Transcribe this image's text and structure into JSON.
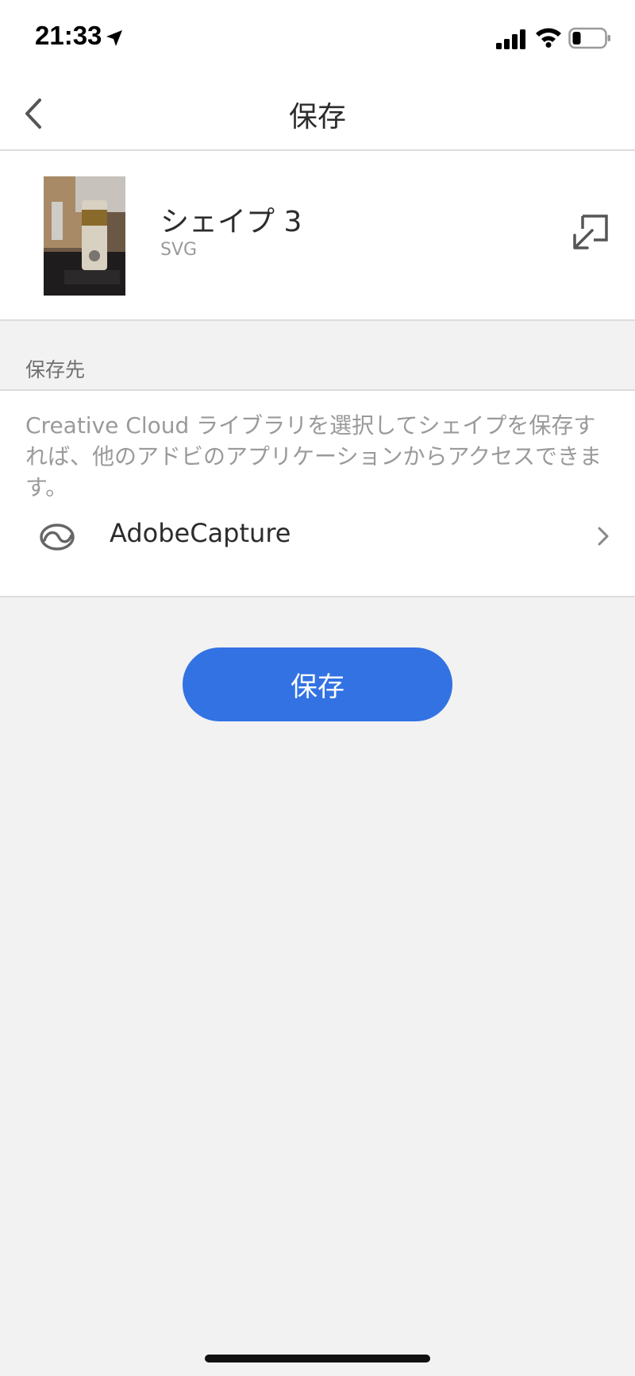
{
  "status_bar": {
    "time": "21:33",
    "icons": [
      "location-arrow-icon",
      "cellular-signal-icon",
      "wifi-icon",
      "battery-icon"
    ]
  },
  "nav": {
    "title": "保存",
    "back_icon": "chevron-left-icon"
  },
  "item": {
    "name": "シェイプ 3",
    "format": "SVG",
    "thumbnail": "photo-thumbnail",
    "export_icon": "export-arrow-icon"
  },
  "destination": {
    "section_label": "保存先",
    "description": "Creative Cloud ライブラリを選択してシェイプを保存すれば、他のアドビのアプリケーションからアクセスできます。",
    "library": {
      "name": "AdobeCapture",
      "icon": "creative-cloud-icon",
      "chevron_icon": "chevron-right-icon"
    }
  },
  "actions": {
    "save_label": "保存"
  },
  "colors": {
    "accent": "#3272e3",
    "background": "#f2f2f3",
    "card": "#ffffff",
    "text_primary": "#2c2c2c",
    "text_secondary": "#9a9a9a"
  }
}
